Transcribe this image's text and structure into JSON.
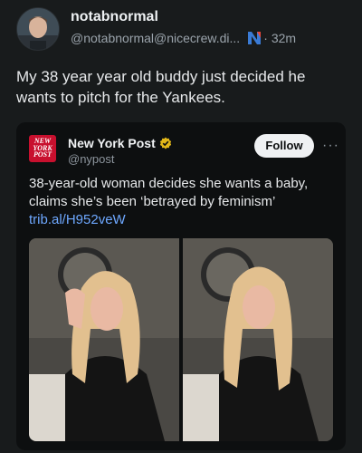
{
  "post": {
    "author_name": "notabnormal",
    "author_handle": "@notabnormal@nicecrew.di...",
    "client_icon": "n-logo-icon",
    "separator": "·",
    "time": "32m",
    "text": "My 38 year year old buddy just decided he wants to pitch for the Yankees."
  },
  "quoted": {
    "logo_text": "NEW YORK POST",
    "name": "New York Post",
    "verified_icon": "verified-badge-icon",
    "handle": "@nypost",
    "follow_label": "Follow",
    "more_icon": "more-dots-icon",
    "more_glyph": "···",
    "text": "38-year-old woman decides she wants a baby, claims she’s been ‘betrayed by feminism’",
    "link": "trib.al/H952veW",
    "images": [
      "photo-left",
      "photo-right"
    ]
  },
  "colors": {
    "background": "#181b1c",
    "card": "#0d0f10",
    "link": "#6ea8ff",
    "nypost_red": "#c8102e",
    "verified_gold": "#e2b719"
  }
}
